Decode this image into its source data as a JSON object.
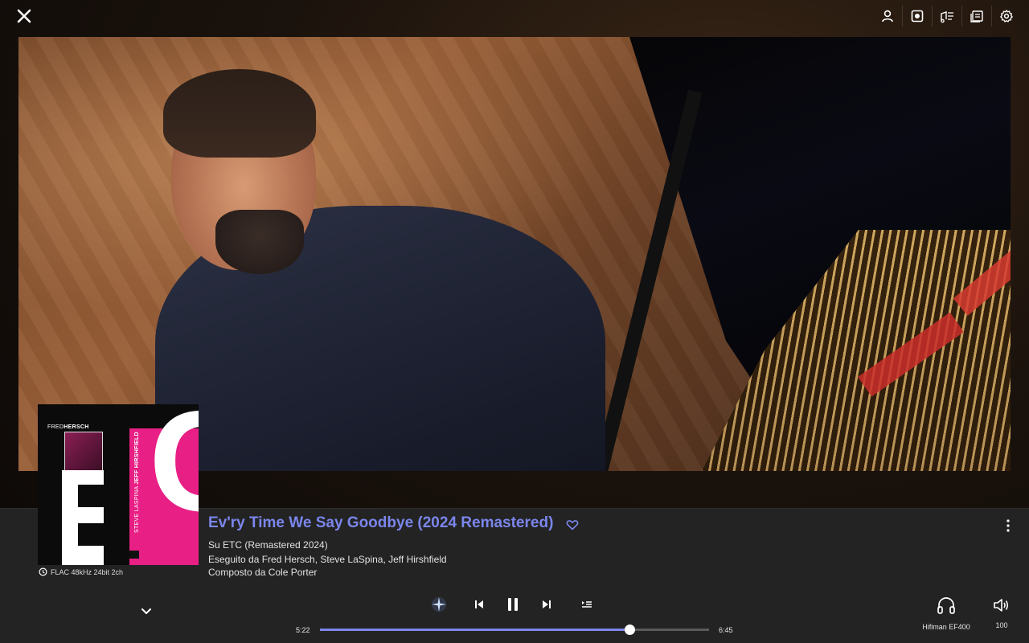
{
  "track": {
    "title": "Ev'ry Time We Say Goodbye (2024 Remastered)",
    "album_line": "Su ETC (Remastered 2024)",
    "artists_line": "Eseguito da Fred Hersch, Steve LaSpina, Jeff Hirshfield",
    "composer_line": "Composto da Cole Porter",
    "format": "FLAC 48kHz 24bit 2ch"
  },
  "album_art": {
    "artist_first": "FRED",
    "artist_last": "HERSCH",
    "side_text_1": "STEVE LASPINA",
    "side_text_2": "JEFF HIRSHFIELD",
    "logo_text": "ETC"
  },
  "playback": {
    "elapsed": "5:22",
    "total": "6:45",
    "progress_fraction": 0.795,
    "state": "playing"
  },
  "output": {
    "device_name": "Hifiman EF400",
    "volume": "100"
  },
  "top_icons": [
    "profile-icon",
    "radio-icon",
    "lyrics-icon",
    "queue-icon",
    "settings-icon"
  ],
  "colors": {
    "accent": "#7b86ec",
    "panel_bg": "#232323"
  }
}
